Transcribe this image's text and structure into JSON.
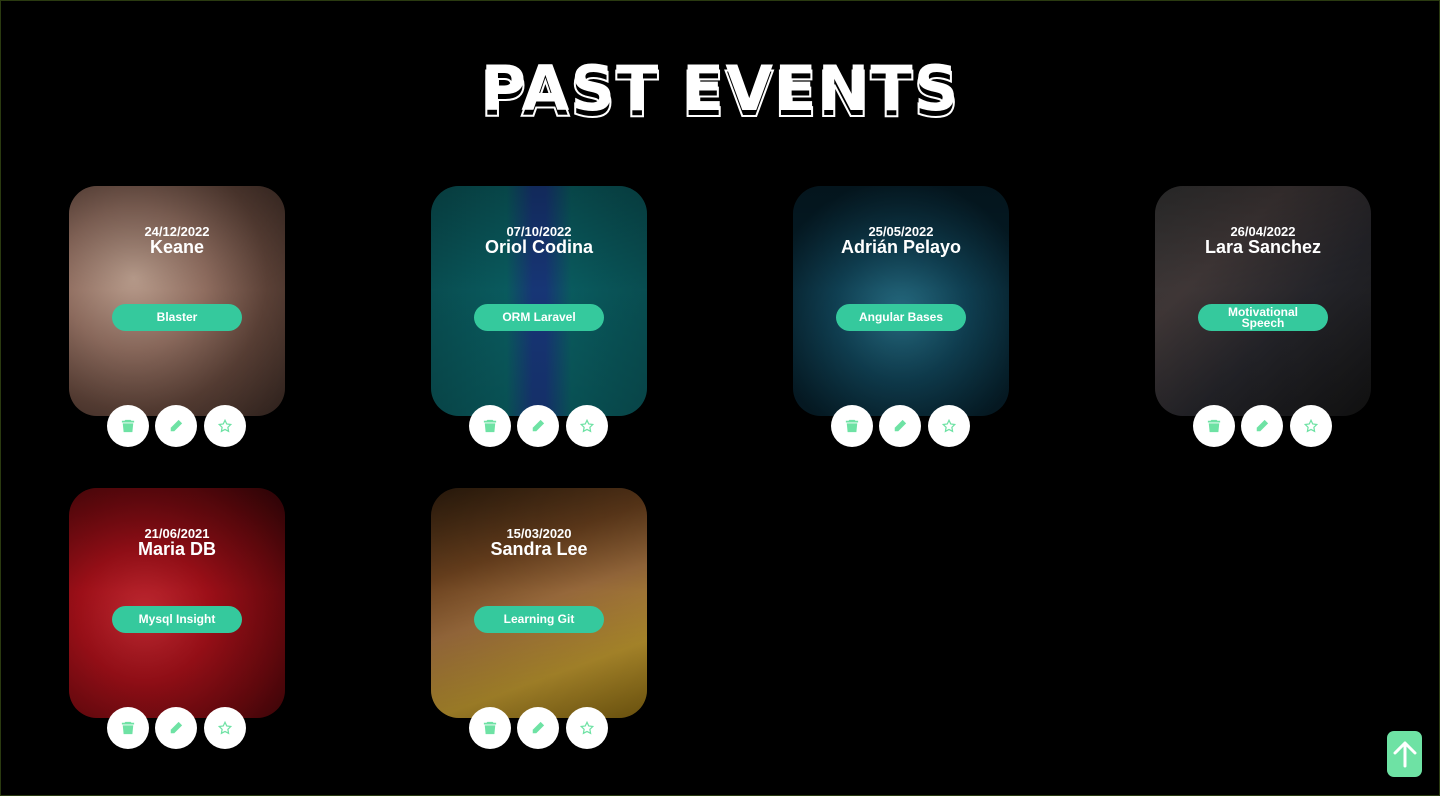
{
  "page": {
    "title": "PAST EVENTS"
  },
  "colors": {
    "accent": "#35c99d",
    "icon": "#6ee2a4",
    "background": "#000000"
  },
  "events": [
    {
      "date": "24/12/2022",
      "speaker": "Keane",
      "topic": "Blaster"
    },
    {
      "date": "07/10/2022",
      "speaker": "Oriol Codina",
      "topic": "ORM Laravel"
    },
    {
      "date": "25/05/2022",
      "speaker": "Adrián Pelayo",
      "topic": "Angular Bases"
    },
    {
      "date": "26/04/2022",
      "speaker": "Lara Sanchez",
      "topic": "Motivational Speech"
    },
    {
      "date": "21/06/2021",
      "speaker": "Maria DB",
      "topic": "Mysql Insight"
    },
    {
      "date": "15/03/2020",
      "speaker": "Sandra Lee",
      "topic": "Learning Git"
    }
  ],
  "actions": {
    "icons": [
      "trash-icon",
      "pencil-icon",
      "star-icon"
    ]
  },
  "scroll_top": {
    "icon": "arrow-up-icon"
  }
}
